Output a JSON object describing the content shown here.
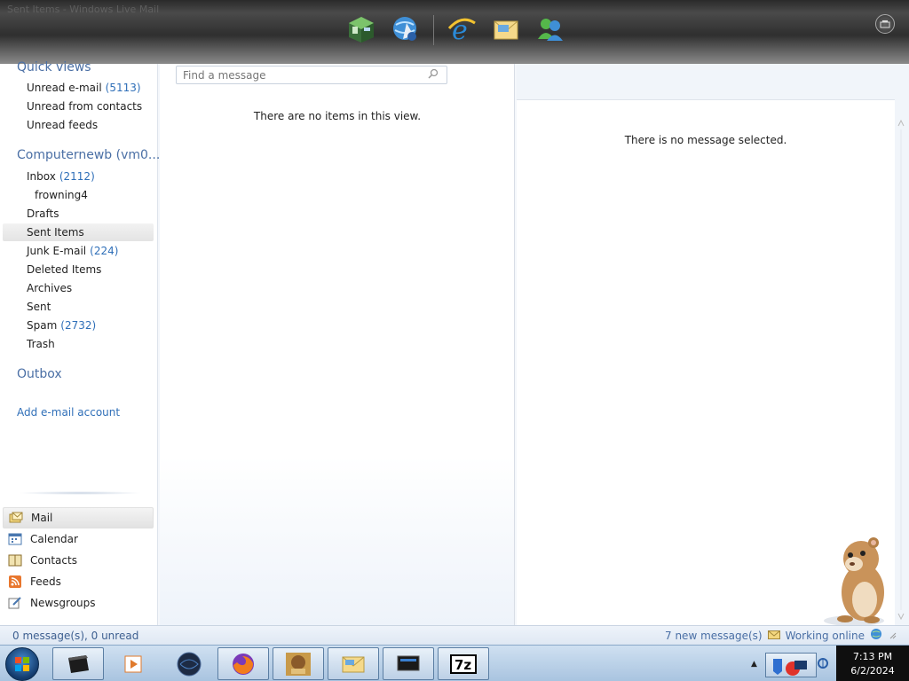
{
  "window": {
    "ghost_title": "Sent Items - Windows Live Mail"
  },
  "dock": {
    "icons": [
      "desktop-cube-icon",
      "network-globe-icon",
      "internet-explorer-icon",
      "mail-envelope-icon",
      "messenger-buddies-icon"
    ]
  },
  "folders": {
    "quick_views_label": "Quick views",
    "quick_views": [
      {
        "label": "Unread e-mail",
        "count": "(5113)"
      },
      {
        "label": "Unread from contacts",
        "count": ""
      },
      {
        "label": "Unread feeds",
        "count": ""
      }
    ],
    "account_label": "Computernewb (vm0...",
    "items": [
      {
        "label": "Inbox",
        "count": "(2112)"
      },
      {
        "label": "frowning4",
        "count": ""
      },
      {
        "label": "Drafts",
        "count": ""
      },
      {
        "label": "Sent Items",
        "count": ""
      },
      {
        "label": "Junk E-mail",
        "count": "(224)"
      },
      {
        "label": "Deleted Items",
        "count": ""
      },
      {
        "label": "Archives",
        "count": ""
      },
      {
        "label": "Sent",
        "count": ""
      },
      {
        "label": "Spam",
        "count": "(2732)"
      },
      {
        "label": "Trash",
        "count": ""
      }
    ],
    "outbox_label": "Outbox",
    "add_account": "Add e-mail account"
  },
  "nav": [
    {
      "label": "Mail",
      "icon": "mail-icon"
    },
    {
      "label": "Calendar",
      "icon": "calendar-icon"
    },
    {
      "label": "Contacts",
      "icon": "contacts-icon"
    },
    {
      "label": "Feeds",
      "icon": "rss-feed-icon"
    },
    {
      "label": "Newsgroups",
      "icon": "newsgroups-icon"
    }
  ],
  "message_list": {
    "search_placeholder": "Find a message",
    "empty_text": "There are no items in this view."
  },
  "reading_pane": {
    "empty_text": "There is no message selected."
  },
  "status": {
    "left": "0 message(s), 0 unread",
    "new_messages": "7 new message(s)",
    "online": "Working online"
  },
  "clock": {
    "time": "7:13 PM",
    "date": "6/2/2024"
  },
  "colors": {
    "accent": "#4a6fa5",
    "link": "#2f6fb8"
  }
}
